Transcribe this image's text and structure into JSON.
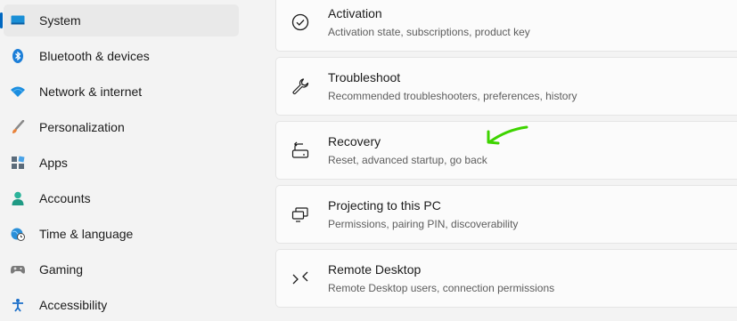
{
  "sidebar": {
    "items": [
      {
        "label": "System",
        "selected": true,
        "icon": "monitor-icon"
      },
      {
        "label": "Bluetooth & devices",
        "icon": "bluetooth-icon"
      },
      {
        "label": "Network & internet",
        "icon": "wifi-icon"
      },
      {
        "label": "Personalization",
        "icon": "brush-icon"
      },
      {
        "label": "Apps",
        "icon": "apps-icon"
      },
      {
        "label": "Accounts",
        "icon": "person-icon"
      },
      {
        "label": "Time & language",
        "icon": "globe-clock-icon"
      },
      {
        "label": "Gaming",
        "icon": "controller-icon"
      },
      {
        "label": "Accessibility",
        "icon": "accessibility-icon"
      }
    ]
  },
  "main": {
    "cards": [
      {
        "title": "Activation",
        "subtitle": "Activation state, subscriptions, product key",
        "icon": "checkmark-circle-icon"
      },
      {
        "title": "Troubleshoot",
        "subtitle": "Recommended troubleshooters, preferences, history",
        "icon": "wrench-icon"
      },
      {
        "title": "Recovery",
        "subtitle": "Reset, advanced startup, go back",
        "icon": "recovery-icon"
      },
      {
        "title": "Projecting to this PC",
        "subtitle": "Permissions, pairing PIN, discoverability",
        "icon": "project-icon"
      },
      {
        "title": "Remote Desktop",
        "subtitle": "Remote Desktop users, connection permissions",
        "icon": "remote-desktop-icon"
      }
    ]
  },
  "annotation": {
    "color": "#3ed400",
    "icon": "arrow-annotation"
  },
  "colors": {
    "accent": "#0067c0",
    "background": "#f3f3f3",
    "card": "#fbfbfb"
  }
}
